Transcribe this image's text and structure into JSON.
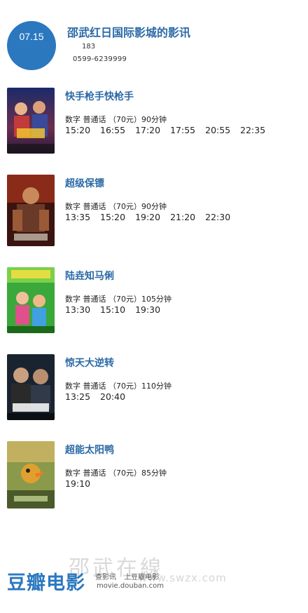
{
  "header": {
    "date": "07.15",
    "cinema_title": "邵武红日国际影城的影讯",
    "meta_line1": "183",
    "meta_line2": "0599-6239999"
  },
  "movies": [
    {
      "title": "快手枪手快枪手",
      "info": "数字  普通话 （70元）90分钟",
      "times": [
        "15:20",
        "16:55",
        "17:20",
        "17:55",
        "20:55",
        "22:35"
      ]
    },
    {
      "title": "超级保镖",
      "info": "数字  普通话 （70元）90分钟",
      "times": [
        "13:35",
        "15:20",
        "19:20",
        "21:20",
        "22:30"
      ]
    },
    {
      "title": "陆垚知马俐",
      "info": "数字  普通话 （70元）105分钟",
      "times": [
        "13:30",
        "15:10",
        "19:30"
      ]
    },
    {
      "title": "惊天大逆转",
      "info": "数字  普通话 （70元）110分钟",
      "times": [
        "13:25",
        "20:40"
      ]
    },
    {
      "title": "超能太阳鸭",
      "info": "数字  普通话 （70元）85分钟",
      "times": [
        "19:10"
      ]
    }
  ],
  "footer": {
    "logo": "豆瓣电影",
    "links": [
      "查影讯",
      "上豆瓣电影"
    ],
    "site": "movie.douban.com",
    "watermark": "邵武在線",
    "watermark_sub": "www.swzx.com"
  },
  "colors": {
    "accent": "#2b78bf",
    "title_blue": "#2b6aa6"
  }
}
